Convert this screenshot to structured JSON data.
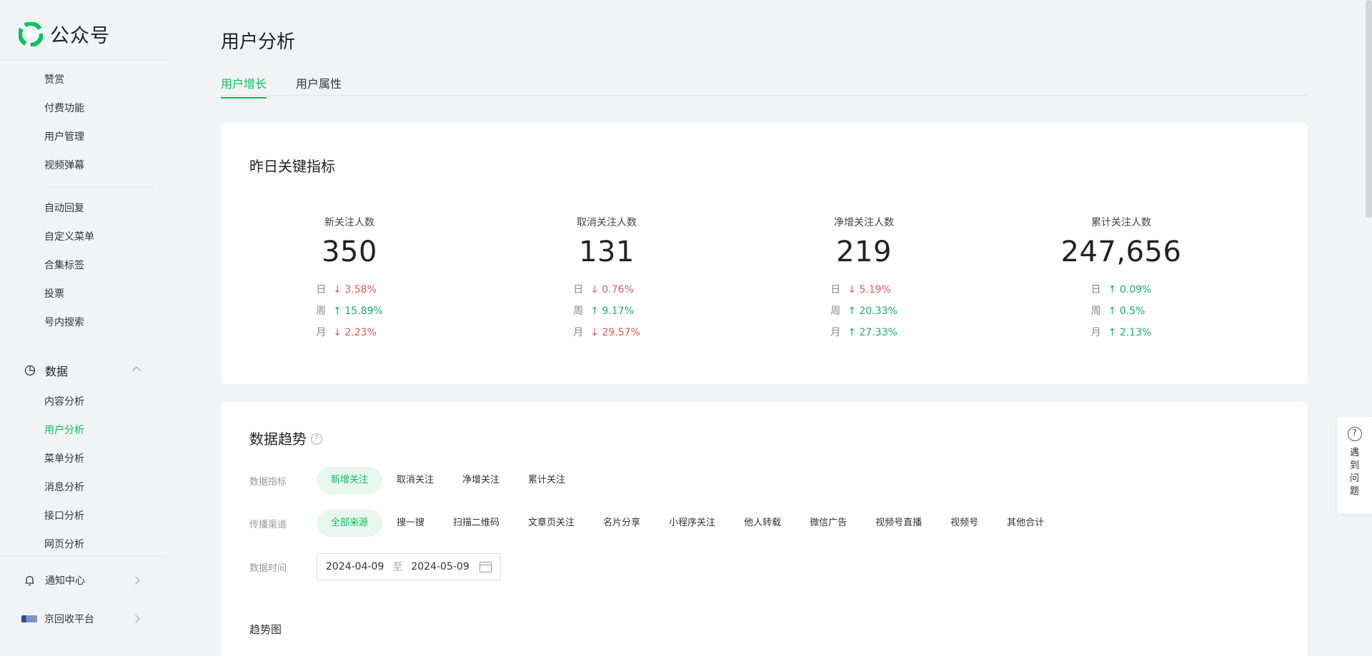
{
  "app": {
    "logo_text": "公众号"
  },
  "sidebar": {
    "items_top": [
      "赞赏",
      "付费功能",
      "用户管理",
      "视频弹幕"
    ],
    "items_mid": [
      "自动回复",
      "自定义菜单",
      "合集标签",
      "投票",
      "号内搜索"
    ],
    "data_group": {
      "label": "数据"
    },
    "data_items": [
      "内容分析",
      "用户分析",
      "菜单分析",
      "消息分析",
      "接口分析",
      "网页分析"
    ],
    "notify": {
      "label": "通知中心"
    },
    "account": {
      "label": "京回收平台"
    }
  },
  "main": {
    "title": "用户分析",
    "tabs": [
      {
        "label": "用户增长"
      },
      {
        "label": "用户属性"
      }
    ],
    "key_metrics": {
      "title": "昨日关键指标",
      "metrics": [
        {
          "label": "新关注人数",
          "value": "350",
          "changes": [
            {
              "period": "日",
              "dir": "down",
              "text": "↓ 3.58%"
            },
            {
              "period": "周",
              "dir": "up",
              "text": "↑ 15.89%"
            },
            {
              "period": "月",
              "dir": "down",
              "text": "↓ 2.23%"
            }
          ]
        },
        {
          "label": "取消关注人数",
          "value": "131",
          "changes": [
            {
              "period": "日",
              "dir": "down",
              "text": "↓ 0.76%"
            },
            {
              "period": "周",
              "dir": "up",
              "text": "↑ 9.17%"
            },
            {
              "period": "月",
              "dir": "down",
              "text": "↓ 29.57%"
            }
          ]
        },
        {
          "label": "净增关注人数",
          "value": "219",
          "changes": [
            {
              "period": "日",
              "dir": "down",
              "text": "↓ 5.19%"
            },
            {
              "period": "周",
              "dir": "up",
              "text": "↑ 20.33%"
            },
            {
              "period": "月",
              "dir": "up",
              "text": "↑ 27.33%"
            }
          ]
        },
        {
          "label": "累计关注人数",
          "value": "247,656",
          "changes": [
            {
              "period": "日",
              "dir": "up",
              "text": "↑ 0.09%"
            },
            {
              "period": "周",
              "dir": "up",
              "text": "↑ 0.5%"
            },
            {
              "period": "月",
              "dir": "up",
              "text": "↑ 2.13%"
            }
          ]
        }
      ]
    },
    "trend": {
      "title": "数据趋势",
      "metric_label": "数据指标",
      "metric_options": [
        "新增关注",
        "取消关注",
        "净增关注",
        "累计关注"
      ],
      "channel_label": "传播渠道",
      "channel_options": [
        "全部来源",
        "搜一搜",
        "扫描二维码",
        "文章页关注",
        "名片分享",
        "小程序关注",
        "他人转载",
        "微信广告",
        "视频号直播",
        "视频号",
        "其他合计"
      ],
      "time_label": "数据时间",
      "date_start": "2024-04-09",
      "date_sep": "至",
      "date_end": "2024-05-09",
      "chart_title": "趋势图"
    }
  },
  "float_help": {
    "text": "遇到问题"
  },
  "colors": {
    "accent": "#07c160",
    "down": "#e05a5a",
    "up": "#1aad6a"
  }
}
